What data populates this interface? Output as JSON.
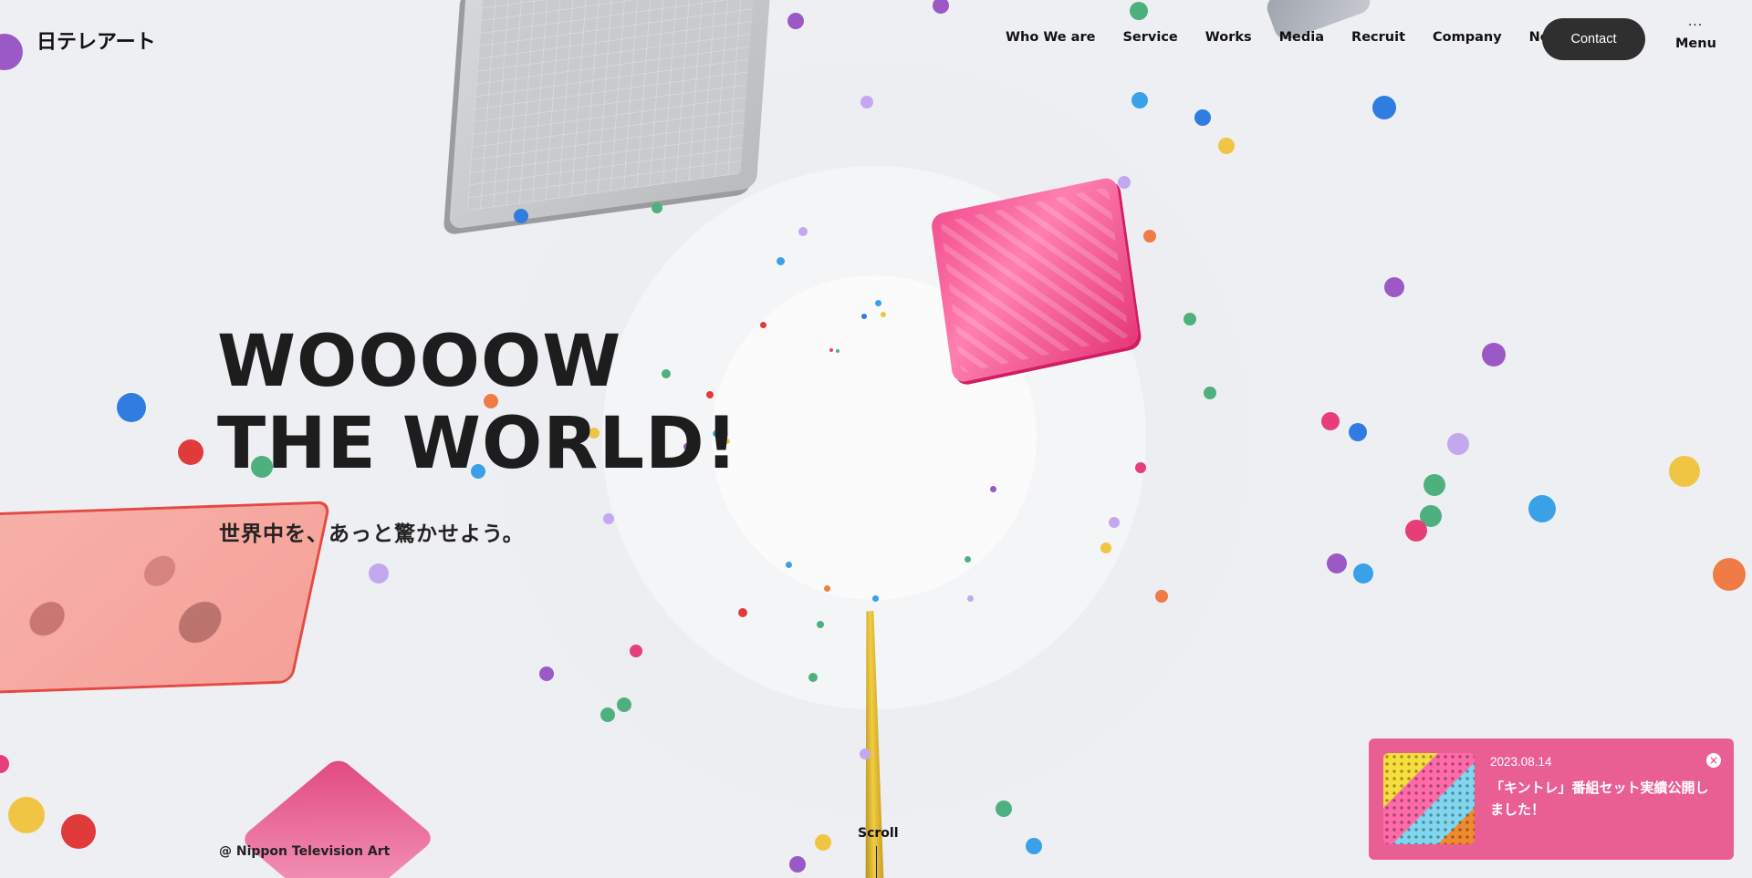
{
  "header": {
    "logo": "日テレアート",
    "nav": [
      {
        "label": "Who We are"
      },
      {
        "label": "Service"
      },
      {
        "label": "Works"
      },
      {
        "label": "Media"
      },
      {
        "label": "Recruit"
      },
      {
        "label": "Company"
      },
      {
        "label": "News"
      }
    ],
    "contact_label": "Contact",
    "menu_label": "Menu"
  },
  "hero": {
    "title_line1": "WOOOOW",
    "title_line2": "THE WORLD!",
    "subtitle": "世界中を、あっと驚かせよう。"
  },
  "footer": {
    "copyright": "@ Nippon Television Art",
    "scroll_label": "Scroll"
  },
  "news_toast": {
    "date": "2023.08.14",
    "title": "「キントレ」番組セット実績公開しました！",
    "close_icon": "close-icon",
    "background": "#ea5f93"
  },
  "colors": {
    "purple": "#9b59c6",
    "lavender": "#c3a8f0",
    "blue": "#2f7de0",
    "sky": "#3aa0e8",
    "green": "#4fb07f",
    "yellow": "#f0c544",
    "red": "#e03a3a",
    "pink": "#e83e78",
    "orange": "#ef7c46"
  }
}
